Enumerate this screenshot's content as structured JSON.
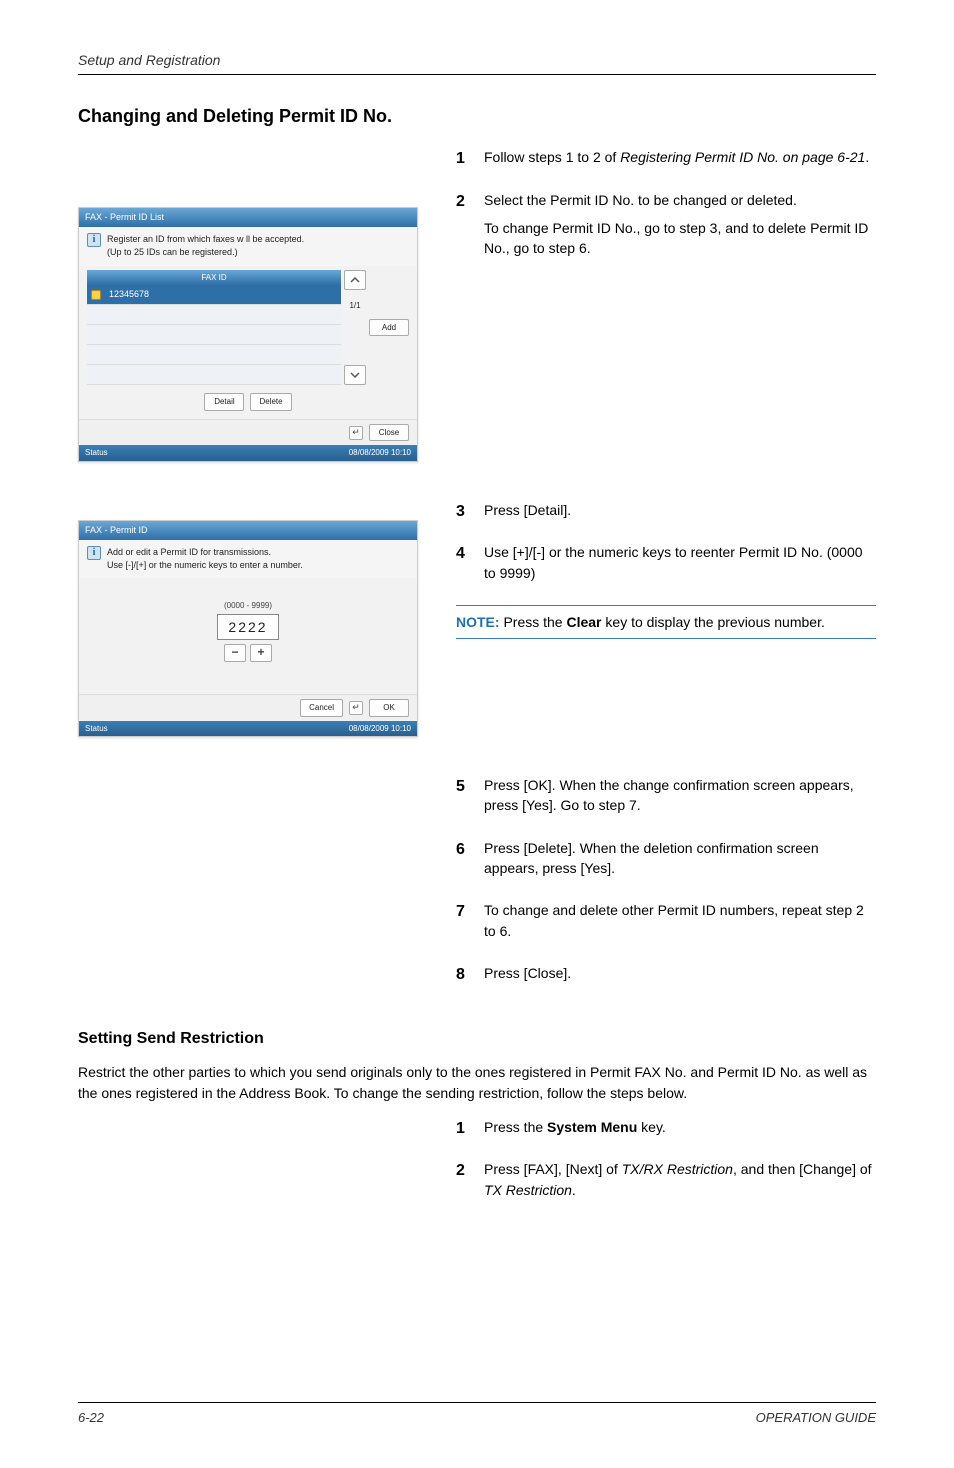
{
  "header": {
    "section": "Setup and Registration"
  },
  "title": "Changing and Deleting Permit ID No.",
  "panel1": {
    "title": "FAX - Permit ID List",
    "info_icon": "i",
    "info_line1": "Register an ID from which faxes w ll be accepted.",
    "info_line2": "(Up to 25 IDs can be registered.)",
    "col_header": "FAX ID",
    "row_value": "12345678",
    "page_indicator": "1/1",
    "btn_add": "Add",
    "btn_detail": "Detail",
    "btn_delete": "Delete",
    "btn_close": "Close",
    "status_label": "Status",
    "status_time": "08/08/2009   10:10"
  },
  "panel2": {
    "title": "FAX - Permit ID",
    "info_icon": "i",
    "info_line1": "Add or edit a Permit ID for transmissions.",
    "info_line2": "Use [-]/[+] or the numeric keys to enter a number.",
    "range": "(0000 - 9999)",
    "value": "2222",
    "btn_cancel": "Cancel",
    "btn_ok": "OK",
    "status_label": "Status",
    "status_time": "08/08/2009   10:10"
  },
  "steps": {
    "s1": {
      "num": "1",
      "text_a": "Follow steps 1 to 2 of ",
      "text_b": "Registering Permit ID No. on page 6-21",
      "text_c": "."
    },
    "s2": {
      "num": "2",
      "text_a": "Select the Permit ID No. to be changed or deleted.",
      "text_b": "To change Permit ID No., go to step 3, and to delete Permit ID No., go to step 6."
    },
    "s3": {
      "num": "3",
      "text": "Press [Detail]."
    },
    "s4": {
      "num": "4",
      "text": "Use [+]/[-] or the numeric keys to reenter Permit ID No. (0000 to 9999)"
    },
    "note": {
      "label": "NOTE:",
      "text_a": " Press the ",
      "bold": "Clear",
      "text_b": " key to display the previous number."
    },
    "s5": {
      "num": "5",
      "text": "Press [OK]. When the change confirmation screen appears, press [Yes]. Go to step 7."
    },
    "s6": {
      "num": "6",
      "text": "Press [Delete]. When the deletion confirmation screen appears, press [Yes]."
    },
    "s7": {
      "num": "7",
      "text": "To change and delete other Permit ID numbers, repeat step 2 to 6."
    },
    "s8": {
      "num": "8",
      "text": "Press [Close]."
    }
  },
  "sub": {
    "heading": "Setting Send Restriction",
    "para": "Restrict the other parties to which you send originals only to the ones registered in Permit FAX No. and Permit ID No. as well as the ones registered in the Address Book. To change the sending restriction, follow the steps below.",
    "s1": {
      "num": "1",
      "text_a": "Press the ",
      "bold": "System Menu",
      "text_b": " key."
    },
    "s2": {
      "num": "2",
      "text_a": "Press [FAX], [Next] of ",
      "ital1": "TX/RX Restriction",
      "text_b": ", and then [Change] of ",
      "ital2": "TX Restriction",
      "text_c": "."
    }
  },
  "footer": {
    "page": "6-22",
    "guide": "OPERATION GUIDE"
  }
}
